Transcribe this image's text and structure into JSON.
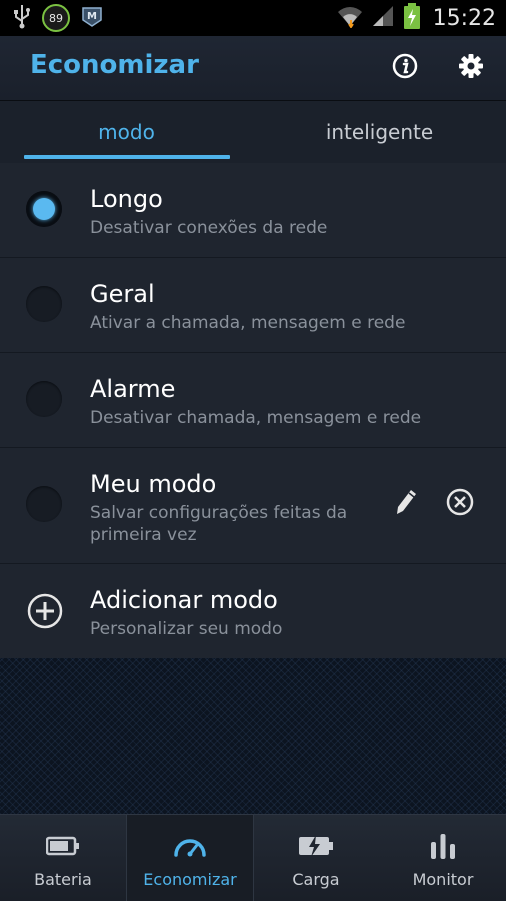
{
  "status_bar": {
    "notification_count": "89",
    "clock": "15:22"
  },
  "header": {
    "title": "Economizar"
  },
  "tabs": [
    {
      "label": "modo"
    },
    {
      "label": "inteligente"
    }
  ],
  "modes": [
    {
      "title": "Longo",
      "subtitle": "Desativar conexões da rede"
    },
    {
      "title": "Geral",
      "subtitle": "Ativar a chamada, mensagem e rede"
    },
    {
      "title": "Alarme",
      "subtitle": "Desativar chamada, mensagem e rede"
    },
    {
      "title": "Meu modo",
      "subtitle_line1": "Salvar configurações feitas da",
      "subtitle_line2": "primeira vez"
    }
  ],
  "add_mode": {
    "title": "Adicionar modo",
    "subtitle": "Personalizar seu modo"
  },
  "bottom_nav": [
    {
      "label": "Bateria",
      "icon": "battery-icon"
    },
    {
      "label": "Economizar",
      "icon": "speedometer-icon"
    },
    {
      "label": "Carga",
      "icon": "charging-icon"
    },
    {
      "label": "Monitor",
      "icon": "bars-icon"
    }
  ],
  "colors": {
    "accent": "#4fb3ea",
    "background": "#1f252f"
  }
}
